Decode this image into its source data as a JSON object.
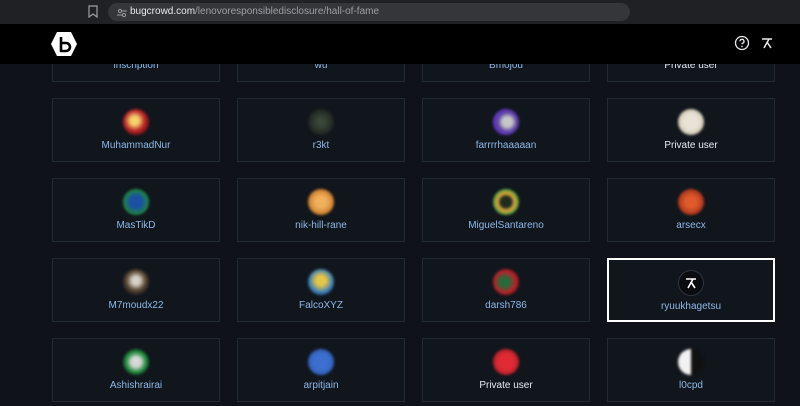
{
  "browser": {
    "url_domain": "bugcrowd.com",
    "url_path": "/lenovoresponsibledisclosure/hall-of-fame"
  },
  "header": {
    "logo_icon": "bugcrowd-logo",
    "help_icon": "help-circle-icon",
    "user_icon": "user-avatar-icon"
  },
  "colors": {
    "background": "#0f1319",
    "card_border": "#222a34",
    "link": "#8fb8e8",
    "highlight_border": "#ffffff"
  },
  "researchers": [
    {
      "name": "inscription",
      "private": false,
      "avatar": "#6a7482"
    },
    {
      "name": "wu",
      "private": false,
      "avatar": "#3b4a56"
    },
    {
      "name": "Bmojou",
      "private": false,
      "avatar": "#556070"
    },
    {
      "name": "Private user",
      "private": true,
      "avatar": "#cfc7b3"
    },
    {
      "name": "MuhammadNur",
      "private": false,
      "avatar": "radial-gradient(circle at 45% 45%, #f5d36b 20%, #b82428 50%, #6b0e12 80%)"
    },
    {
      "name": "r3kt",
      "private": false,
      "avatar": "radial-gradient(circle at 50% 50%, #3a4638 20%, #1e2521 70%)"
    },
    {
      "name": "farrrrhaaaaan",
      "private": false,
      "avatar": "radial-gradient(circle at 55% 50%, #c7c7c7 25%, #5a3fa0 50%, #6b33d8 75%)"
    },
    {
      "name": "Private user",
      "private": true,
      "avatar": "radial-gradient(circle at 50% 50%, #e8e3d5 40%, #c7bfa8 80%)"
    },
    {
      "name": "MasTikD",
      "private": false,
      "avatar": "radial-gradient(circle at 50% 50%, #1b4fa8 30%, #1f8a3b 70%)"
    },
    {
      "name": "nik-hill-rane",
      "private": false,
      "avatar": "radial-gradient(circle at 50% 50%, #f0b15c 30%, #c97b2b 70%)"
    },
    {
      "name": "MiguelSantareno",
      "private": false,
      "avatar": "radial-gradient(circle at 50% 50%, #1e2b1e 30%, #e5a53a 45%, #2e9a3f 75%)"
    },
    {
      "name": "arsecx",
      "private": false,
      "avatar": "radial-gradient(circle at 50% 50%, #e05a2c 30%, #9b2d17 80%)"
    },
    {
      "name": "M7moudx22",
      "private": false,
      "avatar": "radial-gradient(circle at 50% 45%, #d6d2c8 20%, #5a4632 50%, #1b1b1b 80%)"
    },
    {
      "name": "FalcoXYZ",
      "private": false,
      "avatar": "radial-gradient(circle at 50% 45%, #e8c645 25%, #3b7fb8 60%, #244e82 80%)"
    },
    {
      "name": "darsh786",
      "private": false,
      "avatar": "radial-gradient(circle at 45% 50%, #1d6f3a 20%, #b8232b 55%, #6e0f14 85%)"
    },
    {
      "name": "ryuukhagetsu",
      "private": false,
      "avatar": "#0a0c10"
    },
    {
      "name": "Ashishrairai",
      "private": false,
      "avatar": "radial-gradient(circle at 50% 50%, #d9d9d9 25%, #1f8a3b 55%, #0f3d1c 80%)"
    },
    {
      "name": "arpitjain",
      "private": false,
      "avatar": "radial-gradient(circle at 50% 50%, #3d6fd0 40%, #2f58ad 80%)"
    },
    {
      "name": "Private user",
      "private": true,
      "avatar": "radial-gradient(circle at 50% 50%, #e02b35 40%, #a81d25 80%)"
    },
    {
      "name": "l0cpd",
      "private": false,
      "avatar": "linear-gradient(90deg, #f2f2f2 50%, #111 50%)"
    }
  ],
  "highlighted_researcher": "ryuukhagetsu"
}
